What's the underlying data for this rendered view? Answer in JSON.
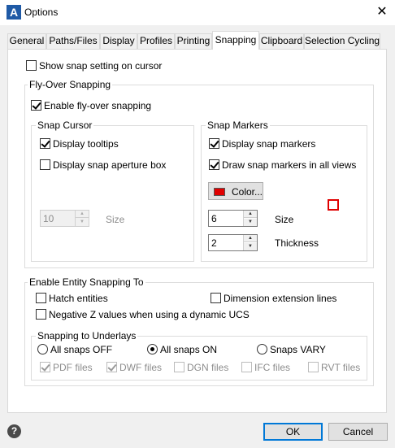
{
  "window": {
    "title": "Options",
    "close_glyph": "✕",
    "app_icon_letter": "A"
  },
  "tabs": [
    {
      "label": "General"
    },
    {
      "label": "Paths/Files"
    },
    {
      "label": "Display"
    },
    {
      "label": "Profiles"
    },
    {
      "label": "Printing"
    },
    {
      "label": "Snapping"
    },
    {
      "label": "Clipboard"
    },
    {
      "label": "Selection Cycling"
    }
  ],
  "active_tab": "Snapping",
  "snapping": {
    "show_snap_setting": {
      "label": "Show snap setting on cursor",
      "checked": false
    },
    "flyover": {
      "group_title": "Fly-Over Snapping",
      "enable": {
        "label": "Enable fly-over snapping",
        "checked": true
      },
      "snap_cursor": {
        "title": "Snap Cursor",
        "display_tooltips": {
          "label": "Display tooltips",
          "checked": true
        },
        "display_aperture": {
          "label": "Display snap aperture box",
          "checked": false
        },
        "size_value": "10",
        "size_label": "Size"
      },
      "snap_markers": {
        "title": "Snap Markers",
        "display_markers": {
          "label": "Display snap markers",
          "checked": true
        },
        "draw_all_views": {
          "label": "Draw snap markers in all views",
          "checked": true
        },
        "color_button": "Color...",
        "color": "#e00000",
        "size_value": "6",
        "size_label": "Size",
        "thickness_value": "2",
        "thickness_label": "Thickness"
      }
    },
    "entity": {
      "group_title": "Enable Entity Snapping To",
      "hatch": {
        "label": "Hatch entities",
        "checked": false
      },
      "dimension": {
        "label": "Dimension extension lines",
        "checked": false
      },
      "negative_z": {
        "label": "Negative Z values when using a dynamic UCS",
        "checked": false
      },
      "underlays": {
        "title": "Snapping to Underlays",
        "radios": [
          {
            "label": "All snaps OFF",
            "checked": false
          },
          {
            "label": "All snaps ON",
            "checked": true
          },
          {
            "label": "Snaps VARY",
            "checked": false
          }
        ],
        "files": [
          {
            "label": "PDF files",
            "checked": true
          },
          {
            "label": "DWF files",
            "checked": true
          },
          {
            "label": "DGN files",
            "checked": false
          },
          {
            "label": "IFC files",
            "checked": false
          },
          {
            "label": "RVT files",
            "checked": false
          }
        ]
      }
    }
  },
  "footer": {
    "ok": "OK",
    "cancel": "Cancel",
    "help_glyph": "?"
  }
}
